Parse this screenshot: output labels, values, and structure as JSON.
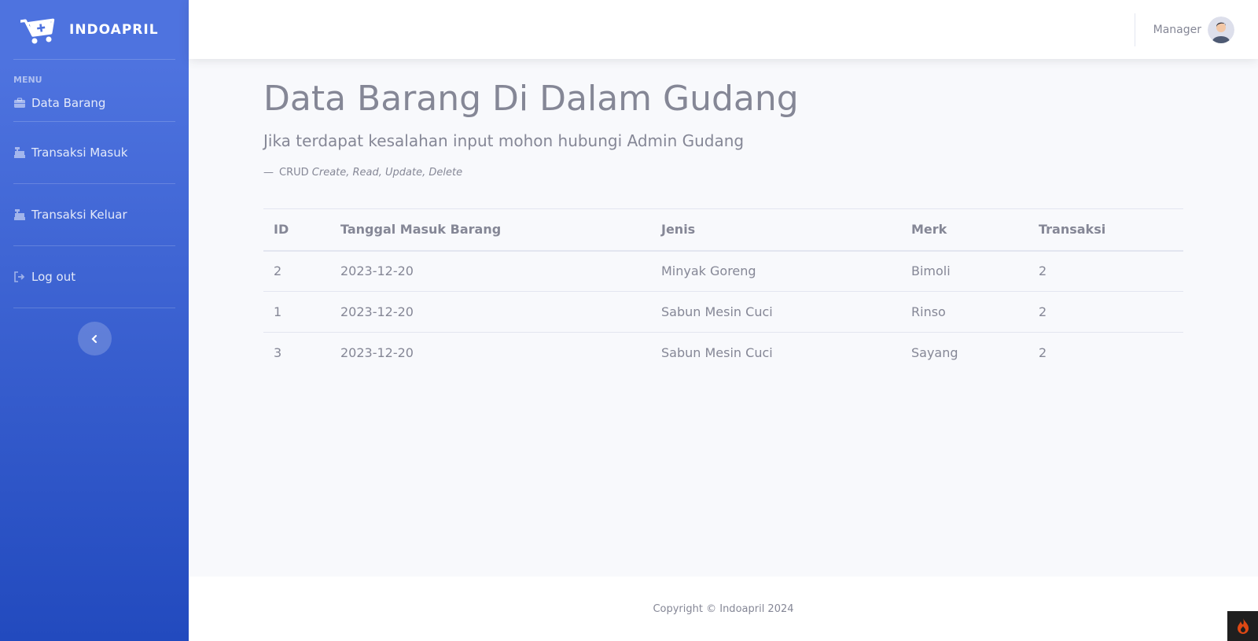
{
  "brand": {
    "name": "INDOAPRIL",
    "icon": "shopping-cart-plus-icon"
  },
  "sidebar": {
    "heading": "MENU",
    "items": [
      {
        "label": "Data Barang",
        "icon": "briefcase-icon"
      },
      {
        "label": "Transaksi Masuk",
        "icon": "cash-register-icon"
      },
      {
        "label": "Transaksi Keluar",
        "icon": "cash-register-icon"
      },
      {
        "label": "Log out",
        "icon": "sign-out-icon"
      }
    ],
    "toggle_icon": "chevron-left-icon"
  },
  "topbar": {
    "user_name": "Manager",
    "avatar_icon": "user-avatar"
  },
  "main": {
    "title": "Data Barang Di Dalam Gudang",
    "lead": "Jika terdapat kesalahan input mohon hubungi Admin Gudang",
    "crud_prefix": "CRUD",
    "crud_detail": "Create, Read, Update, Delete"
  },
  "table": {
    "headers": [
      "ID",
      "Tanggal Masuk Barang",
      "Jenis",
      "Merk",
      "Transaksi"
    ],
    "rows": [
      [
        "2",
        "2023-12-20",
        "Minyak Goreng",
        "Bimoli",
        "2"
      ],
      [
        "1",
        "2023-12-20",
        "Sabun Mesin Cuci",
        "Rinso",
        "2"
      ],
      [
        "3",
        "2023-12-20",
        "Sabun Mesin Cuci",
        "Sayang",
        "2"
      ]
    ]
  },
  "footer": {
    "copyright": "Copyright © Indoapril 2024"
  },
  "colors": {
    "primary": "#4e73df",
    "primary_dark": "#224abe",
    "text": "#858796",
    "background": "#f8f9fc"
  }
}
